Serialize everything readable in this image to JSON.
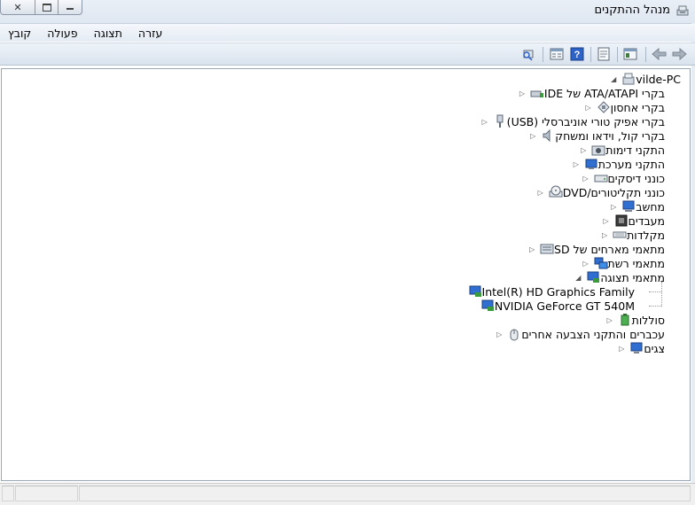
{
  "window": {
    "title": "מנהל ההתקנים",
    "icon": "device-manager-icon"
  },
  "menu": {
    "items": [
      "קובץ",
      "פעולה",
      "תצוגה",
      "עזרה"
    ]
  },
  "toolbar": {
    "buttons": [
      "back-icon",
      "forward-icon",
      "show-hide-tree-icon",
      "properties-icon",
      "help-icon",
      "view-icon",
      "scan-hardware-icon"
    ]
  },
  "tree": {
    "root": "vilde-PC",
    "categories": [
      {
        "label": "בקרי ATA/ATAPI של IDE",
        "icon": "ide-controller-icon"
      },
      {
        "label": "בקרי אחסון",
        "icon": "storage-controller-icon"
      },
      {
        "label": "בקרי אפיק טורי אוניברסלי (USB)",
        "icon": "usb-icon"
      },
      {
        "label": "בקרי קול, וידאו ומשחק",
        "icon": "sound-icon"
      },
      {
        "label": "התקני דימות",
        "icon": "camera-icon"
      },
      {
        "label": "התקני מערכת",
        "icon": "system-device-icon"
      },
      {
        "label": "כונני דיסקים",
        "icon": "disk-drive-icon"
      },
      {
        "label": "כונני תקליטורים/DVD",
        "icon": "dvd-drive-icon"
      },
      {
        "label": "מחשב",
        "icon": "computer-icon"
      },
      {
        "label": "מעבדים",
        "icon": "processor-icon"
      },
      {
        "label": "מקלדות",
        "icon": "keyboard-icon"
      },
      {
        "label": "מתאמי מארחים של SD",
        "icon": "sd-host-icon"
      },
      {
        "label": "מתאמי רשת",
        "icon": "network-adapter-icon"
      },
      {
        "label": "מתאמי תצוגה",
        "icon": "display-adapter-icon",
        "expanded": true,
        "children": [
          {
            "label": "Intel(R) HD Graphics Family",
            "icon": "display-adapter-icon"
          },
          {
            "label": "NVIDIA GeForce GT 540M",
            "icon": "display-adapter-icon"
          }
        ]
      },
      {
        "label": "סוללות",
        "icon": "battery-icon"
      },
      {
        "label": "עכברים והתקני הצבעה אחרים",
        "icon": "mouse-icon"
      },
      {
        "label": "צגים",
        "icon": "monitor-icon"
      }
    ]
  },
  "colors": {
    "titlebar": "#e3eaf3",
    "toolbar": "#dfe8f2",
    "border": "#9aa7b6"
  }
}
